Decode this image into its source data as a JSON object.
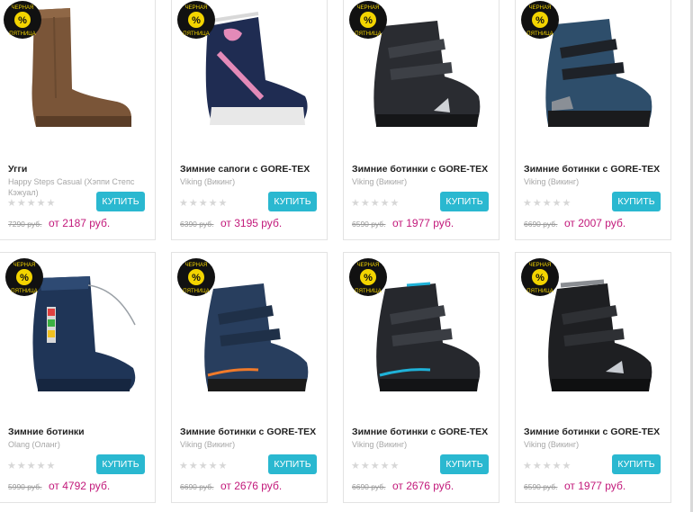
{
  "badge_text": {
    "top": "ЧЕРНАЯ",
    "symbol": "%",
    "bottom": "ПЯТНИЦА"
  },
  "buy_label": "КУПИТЬ",
  "stars": "★★★★★",
  "colors": {
    "accent": "#2ab8d0",
    "price": "#c2187a",
    "badge": "#111111",
    "badge_mark": "#f3d400"
  },
  "products": [
    {
      "title": "Угги",
      "brand": "Happy Steps Casual (Хэппи Степс Кэжуал)",
      "old_price": "7290 руб.",
      "new_price": "от 2187 руб.",
      "image": "brown-ugg-boot",
      "badge": false
    },
    {
      "title": "Зимние сапоги с GORE-TEX",
      "brand": "Viking (Викинг)",
      "old_price": "6390 руб.",
      "new_price": "от 3195 руб.",
      "image": "navy-pink-flower-boot",
      "badge": true
    },
    {
      "title": "Зимние ботинки с GORE-TEX",
      "brand": "Viking (Викинг)",
      "old_price": "6590 руб.",
      "new_price": "от 1977 руб.",
      "image": "black-velcro-boot",
      "badge": true
    },
    {
      "title": "Зимние ботинки с GORE-TEX",
      "brand": "Viking (Викинг)",
      "old_price": "6690 руб.",
      "new_price": "от 2007 руб.",
      "image": "blue-velcro-boot",
      "badge": true
    },
    {
      "title": "Зимние ботинки",
      "brand": "Olang (Оланг)",
      "old_price": "5990 руб.",
      "new_price": "от 4792 руб.",
      "image": "navy-drawstring-boot",
      "badge": true
    },
    {
      "title": "Зимние ботинки с GORE-TEX",
      "brand": "Viking (Викинг)",
      "old_price": "6690 руб.",
      "new_price": "от 2676 руб.",
      "image": "navy-orange-boot",
      "badge": true
    },
    {
      "title": "Зимние ботинки с GORE-TEX",
      "brand": "Viking (Викинг)",
      "old_price": "6690 руб.",
      "new_price": "от 2676 руб.",
      "image": "black-cyan-boot",
      "badge": true
    },
    {
      "title": "Зимние ботинки с GORE-TEX",
      "brand": "Viking (Викинг)",
      "old_price": "6590 руб.",
      "new_price": "от 1977 руб.",
      "image": "black-silver-boot",
      "badge": true
    }
  ]
}
